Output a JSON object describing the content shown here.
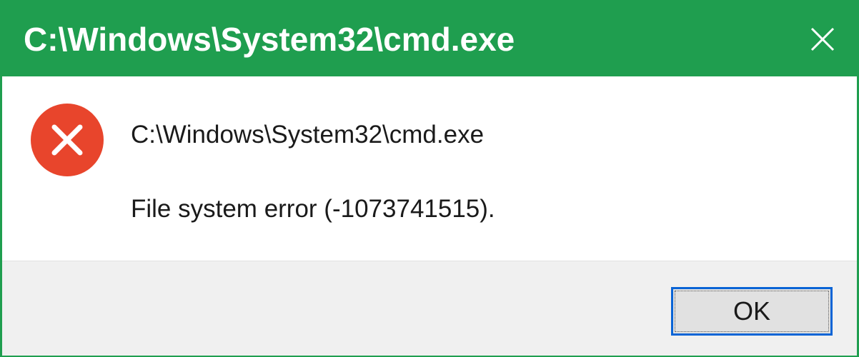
{
  "window": {
    "title": "C:\\Windows\\System32\\cmd.exe",
    "close_icon": "close-icon"
  },
  "dialog": {
    "icon": "error-icon",
    "path": "C:\\Windows\\System32\\cmd.exe",
    "message": "File system error (-1073741515)."
  },
  "buttons": {
    "ok_label": "OK"
  },
  "colors": {
    "title_bar": "#1f9e4f",
    "error_icon": "#e8452c",
    "footer": "#f0f0f0",
    "button_focus_border": "#0a64d6"
  }
}
